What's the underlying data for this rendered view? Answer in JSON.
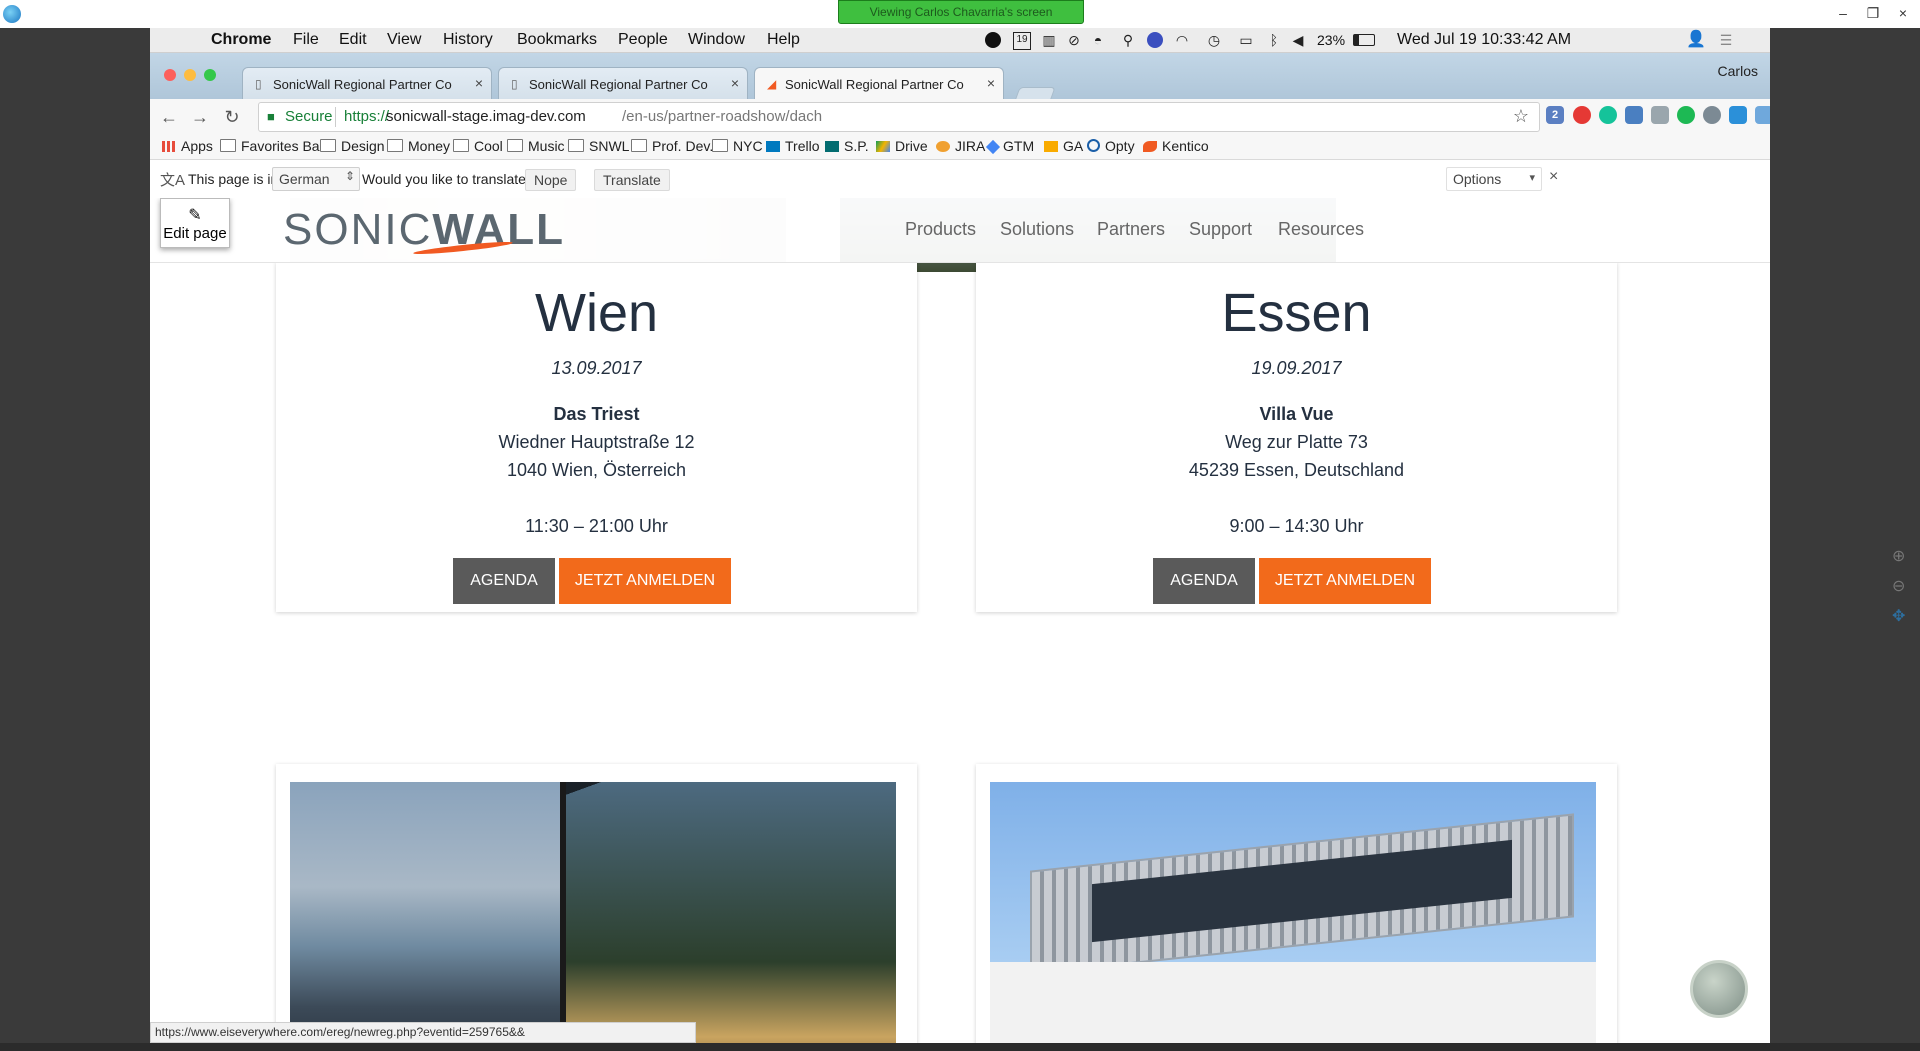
{
  "viewer": {
    "banner": "Viewing Carlos Chavarria's screen",
    "minimize": "–",
    "restore": "❐",
    "close": "×"
  },
  "menubar": {
    "apple": "",
    "items": [
      "Chrome",
      "File",
      "Edit",
      "View",
      "History",
      "Bookmarks",
      "People",
      "Window",
      "Help"
    ],
    "battery": "23%",
    "clock": "Wed Jul 19  10:33:42 AM",
    "calendar_day": "19"
  },
  "browser": {
    "tabs": [
      {
        "title": "SonicWall Regional Partner Co",
        "close": "×"
      },
      {
        "title": "SonicWall Regional Partner Co",
        "close": "×"
      },
      {
        "title": "SonicWall Regional Partner Co",
        "close": "×"
      }
    ],
    "profile": "Carlos",
    "secure_label": "Secure",
    "url_scheme": "https://",
    "url_host": "sonicwall-stage.imag-dev.com",
    "url_path": "/en-us/partner-roadshow/dach",
    "bookmarks": [
      "Apps",
      "Favorites Bar",
      "Design",
      "Money",
      "Cool",
      "Music",
      "SNWL",
      "Prof. Dev.",
      "NYC",
      "Trello",
      "S.P.",
      "Drive",
      "JIRA",
      "GTM",
      "GA",
      "Opty",
      "Kentico"
    ],
    "ext_badge": "2"
  },
  "translate": {
    "prompt": "This page is in",
    "language": "German",
    "question": "Would you like to translate it?",
    "nope": "Nope",
    "translate": "Translate",
    "options": "Options",
    "close": "×"
  },
  "site": {
    "edit_page": "Edit page",
    "logo_light": "SONIC",
    "logo_bold": "WALL",
    "nav": [
      "Products",
      "Solutions",
      "Partners",
      "Support",
      "Resources"
    ]
  },
  "events": [
    {
      "city": "Wien",
      "date": "13.09.2017",
      "venue": "Das Triest",
      "street": "Wiedner Hauptstraße 12",
      "city_line": "1040 Wien, Österreich",
      "time": "11:30 – 21:00 Uhr",
      "agenda": "AGENDA",
      "register": "JETZT ANMELDEN"
    },
    {
      "city": "Essen",
      "date": "19.09.2017",
      "venue": "Villa Vue",
      "street": "Weg zur Platte 73",
      "city_line": "45239 Essen, Deutschland",
      "time": "9:00 – 14:30 Uhr",
      "agenda": "AGENDA",
      "register": "JETZT ANMELDEN"
    }
  ],
  "status_url": "https://www.eiseverywhere.com/ereg/newreg.php?eventid=259765&&"
}
